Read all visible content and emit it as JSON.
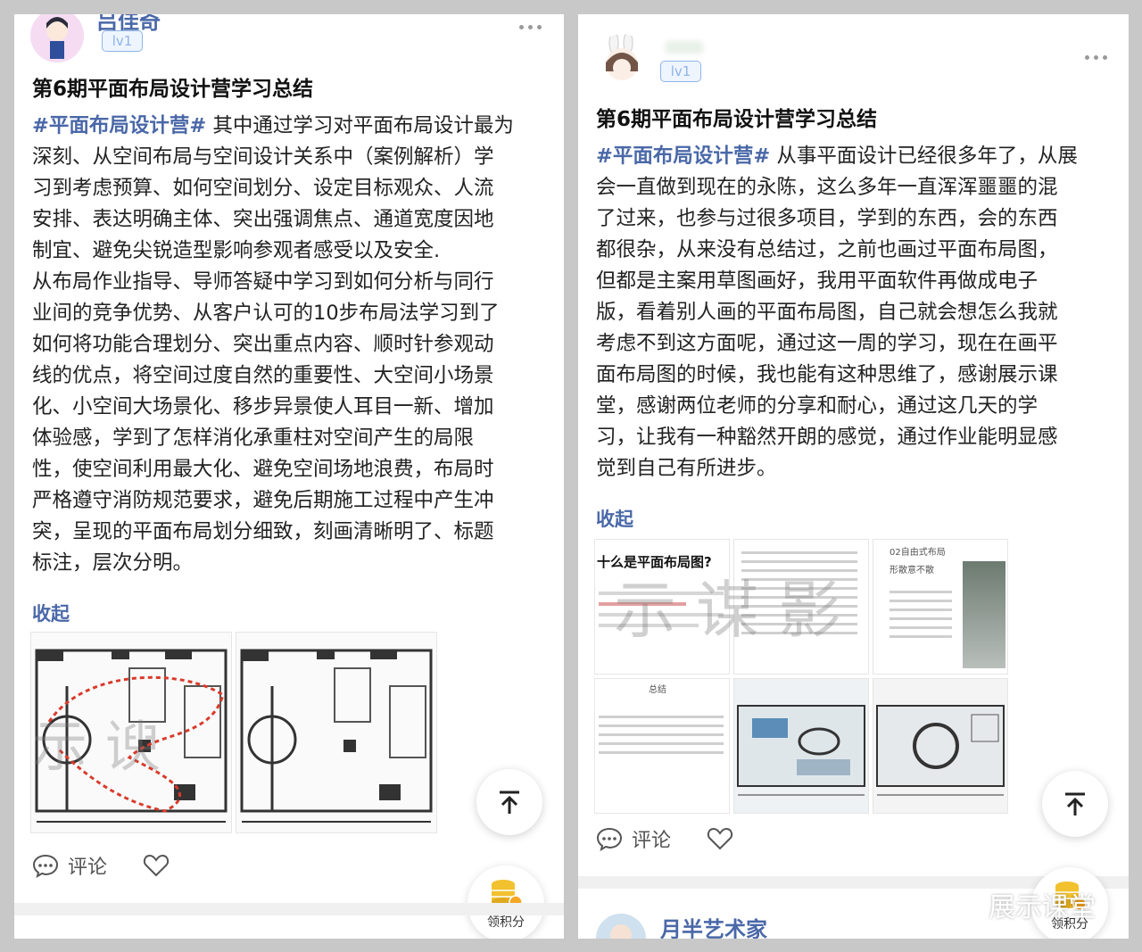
{
  "left_post": {
    "user_name": "吕佳奇",
    "level": "lv1",
    "title": "第6期平面布局设计营学习总结",
    "hashtag": "#平面布局设计营#",
    "body_lines": [
      "其中通过学习对平面布局设计最为",
      "深刻、从空间布局与空间设计关系中（案例解析）学",
      "习到考虑预算、如何空间划分、设定目标观众、人流",
      "安排、表达明确主体、突出强调焦点、通道宽度因地",
      "制宜、避免尖锐造型影响参观者感受以及安全.",
      "从布局作业指导、导师答疑中学习到如何分析与同行",
      "业间的竞争优势、从客户认可的10步布局法学习到了",
      "如何将功能合理划分、突出重点内容、顺时针参观动",
      "线的优点，将空间过度自然的重要性、大空间小场景",
      "化、小空间大场景化、移步异景使人耳目一新、增加",
      "体验感，学到了怎样消化承重柱对空间产生的局限",
      "性，使空间利用最大化、避免空间场地浪费，布局时",
      "严格遵守消防规范要求，避免后期施工过程中产生冲",
      "突，呈现的平面布局划分细致，刻画清晰明了、标题",
      "标注，层次分明。"
    ],
    "collapse_label": "收起",
    "comment_label": "评论",
    "icons": {
      "comment": "comment-icon",
      "like": "heart-icon",
      "top": "back-to-top-icon",
      "points": "coins-icon"
    },
    "points_label": "领积分"
  },
  "right_post": {
    "level": "lv1",
    "title": "第6期平面布局设计营学习总结",
    "hashtag": "#平面布局设计营#",
    "body_lines": [
      "从事平面设计已经很多年了，从展",
      "会一直做到现在的永陈，这么多年一直浑浑噩噩的混",
      "了过来，也参与过很多项目，学到的东西，会的东西",
      "都很杂，从来没有总结过，之前也画过平面布局图，",
      "但都是主案用草图画好，我用平面软件再做成电子",
      "版，看着别人画的平面布局图，自己就会想怎么我就",
      "考虑不到这方面呢，通过这一周的学习，现在在画平",
      "面布局图的时候，我也能有这种思维了，感谢展示课",
      "堂，感谢两位老师的分享和耐心，通过这几天的学",
      "习，让我有一种豁然开朗的感觉，通过作业能明显感",
      "觉到自己有所进步。"
    ],
    "collapse_label": "收起",
    "comment_label": "评论",
    "points_label": "领积分",
    "thumb_heading": "十么是平面布局图?",
    "thumb_section": "02自由式布局",
    "thumb_sub": "形散意不散",
    "thumb_summary": "总结",
    "next_user_name": "月半艺术家"
  },
  "watermark": "展示课堂",
  "colors": {
    "accent": "#4a68a8",
    "level_border": "#8fb4e8",
    "coin": "#f2c12e",
    "route": "#d93a2b"
  }
}
